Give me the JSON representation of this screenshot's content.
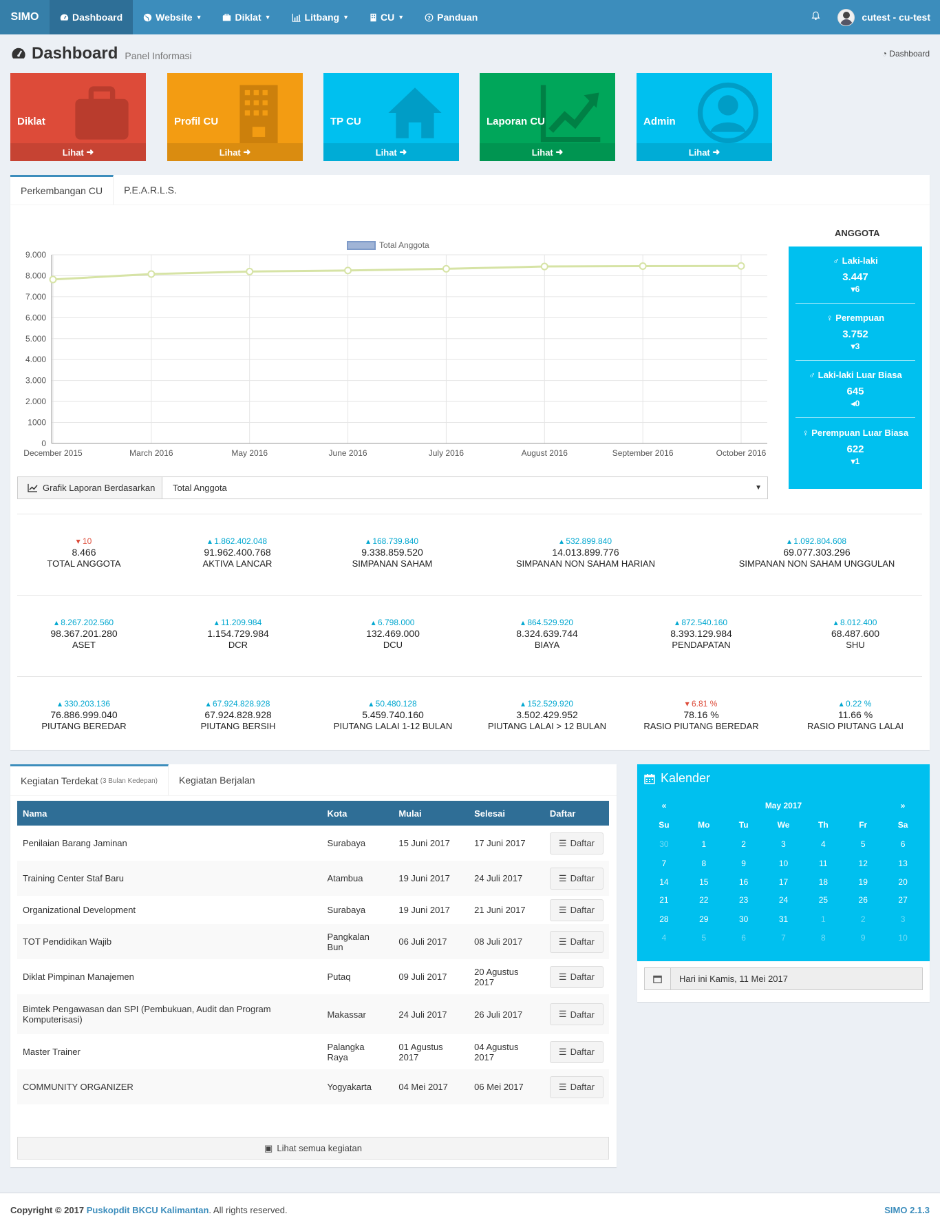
{
  "navbar": {
    "brand": "SIMO",
    "items": [
      {
        "label": "Dashboard",
        "caret": false
      },
      {
        "label": "Website",
        "caret": true
      },
      {
        "label": "Diklat",
        "caret": true
      },
      {
        "label": "Litbang",
        "caret": true
      },
      {
        "label": "CU",
        "caret": true
      },
      {
        "label": "Panduan",
        "caret": false
      }
    ],
    "user": "cutest - cu-test"
  },
  "header": {
    "title": "Dashboard",
    "subtitle": "Panel Informasi",
    "breadcrumb": "Dashboard"
  },
  "tiles": [
    {
      "title": "Diklat",
      "link": "Lihat",
      "color": "#dd4b39",
      "footer_color": "#c64333",
      "icon": "briefcase-icon"
    },
    {
      "title": "Profil CU",
      "link": "Lihat",
      "color": "#f39c12",
      "footer_color": "#da8c10",
      "icon": "building-icon"
    },
    {
      "title": "TP CU",
      "link": "Lihat",
      "color": "#00c0ef",
      "footer_color": "#00acd6",
      "icon": "home-icon"
    },
    {
      "title": "Laporan CU",
      "link": "Lihat",
      "color": "#00a65a",
      "footer_color": "#009551",
      "icon": "line-chart-icon"
    },
    {
      "title": "Admin",
      "link": "Lihat",
      "color": "#00c0ef",
      "footer_color": "#00acd6",
      "icon": "user-circle-icon"
    }
  ],
  "tabs": [
    "Perkembangan CU",
    "P.E.A.R.L.S."
  ],
  "chart_data": {
    "type": "line",
    "categories": [
      "December 2015",
      "March 2016",
      "May 2016",
      "June 2016",
      "July 2016",
      "August 2016",
      "September 2016",
      "October 2016"
    ],
    "series": [
      {
        "name": "Total Anggota",
        "values": [
          7820,
          8080,
          8200,
          8250,
          8330,
          8440,
          8460,
          8466
        ]
      }
    ],
    "ylim": [
      0,
      9000
    ],
    "yticks": [
      "0",
      "1000",
      "2.000",
      "3.000",
      "4.000",
      "5.000",
      "6.000",
      "7.000",
      "8.000",
      "9.000"
    ],
    "legend": "top",
    "grid": true,
    "line_color": "#d6e3a5"
  },
  "anggota": {
    "title": "ANGGOTA",
    "items": [
      {
        "label": "Laki-laki",
        "value": "3.447",
        "delta": "6",
        "dir": "down"
      },
      {
        "label": "Perempuan",
        "value": "3.752",
        "delta": "3",
        "dir": "down"
      },
      {
        "label": "Laki-laki Luar Biasa",
        "value": "645",
        "delta": "0",
        "dir": "left"
      },
      {
        "label": "Perempuan Luar Biasa",
        "value": "622",
        "delta": "1",
        "dir": "down"
      }
    ]
  },
  "grafik": {
    "label": "Grafik Laporan Berdasarkan",
    "selected": "Total Anggota"
  },
  "kpis_row1": [
    {
      "delta": "10",
      "up": false,
      "value": "8.466",
      "label": "TOTAL ANGGOTA"
    },
    {
      "delta": "1.862.402.048",
      "up": true,
      "value": "91.962.400.768",
      "label": "AKTIVA LANCAR"
    },
    {
      "delta": "168.739.840",
      "up": true,
      "value": "9.338.859.520",
      "label": "SIMPANAN SAHAM"
    },
    {
      "delta": "532.899.840",
      "up": true,
      "value": "14.013.899.776",
      "label": "SIMPANAN NON SAHAM HARIAN"
    },
    {
      "delta": "1.092.804.608",
      "up": true,
      "value": "69.077.303.296",
      "label": "SIMPANAN NON SAHAM UNGGULAN"
    }
  ],
  "kpis_row2": [
    {
      "delta": "8.267.202.560",
      "up": true,
      "value": "98.367.201.280",
      "label": "ASET"
    },
    {
      "delta": "11.209.984",
      "up": true,
      "value": "1.154.729.984",
      "label": "DCR"
    },
    {
      "delta": "6.798.000",
      "up": true,
      "value": "132.469.000",
      "label": "DCU"
    },
    {
      "delta": "864.529.920",
      "up": true,
      "value": "8.324.639.744",
      "label": "BIAYA"
    },
    {
      "delta": "872.540.160",
      "up": true,
      "value": "8.393.129.984",
      "label": "PENDAPATAN"
    },
    {
      "delta": "8.012.400",
      "up": true,
      "value": "68.487.600",
      "label": "SHU"
    }
  ],
  "kpis_row3": [
    {
      "delta": "330.203.136",
      "up": true,
      "value": "76.886.999.040",
      "label": "PIUTANG BEREDAR"
    },
    {
      "delta": "67.924.828.928",
      "up": true,
      "value": "67.924.828.928",
      "label": "PIUTANG BERSIH"
    },
    {
      "delta": "50.480.128",
      "up": true,
      "value": "5.459.740.160",
      "label": "PIUTANG LALAI 1-12 BULAN"
    },
    {
      "delta": "152.529.920",
      "up": true,
      "value": "3.502.429.952",
      "label": "PIUTANG LALAI > 12 BULAN"
    },
    {
      "delta": "6.81 %",
      "up": false,
      "value": "78.16 %",
      "label": "RASIO PIUTANG BEREDAR"
    },
    {
      "delta": "0.22 %",
      "up": true,
      "value": "11.66 %",
      "label": "RASIO PIUTANG LALAI"
    }
  ],
  "kegiatan": {
    "tab1": "Kegiatan Terdekat",
    "tab1_small": "(3 Bulan Kedepan)",
    "tab2": "Kegiatan Berjalan",
    "columns": [
      "Nama",
      "Kota",
      "Mulai",
      "Selesai",
      "Daftar"
    ],
    "rows": [
      {
        "nama": "Penilaian Barang Jaminan",
        "kota": "Surabaya",
        "mulai": "15 Juni 2017",
        "selesai": "17 Juni 2017",
        "btn": "Daftar"
      },
      {
        "nama": "Training Center Staf Baru",
        "kota": "Atambua",
        "mulai": "19 Juni 2017",
        "selesai": "24 Juli 2017",
        "btn": "Daftar"
      },
      {
        "nama": "Organizational Development",
        "kota": "Surabaya",
        "mulai": "19 Juni 2017",
        "selesai": "21 Juni 2017",
        "btn": "Daftar"
      },
      {
        "nama": "TOT Pendidikan Wajib",
        "kota": "Pangkalan Bun",
        "mulai": "06 Juli 2017",
        "selesai": "08 Juli 2017",
        "btn": "Daftar"
      },
      {
        "nama": "Diklat Pimpinan Manajemen",
        "kota": "Putaq",
        "mulai": "09 Juli 2017",
        "selesai": "20 Agustus 2017",
        "btn": "Daftar"
      },
      {
        "nama": "Bimtek Pengawasan dan SPI (Pembukuan, Audit dan Program Komputerisasi)",
        "kota": "Makassar",
        "mulai": "24 Juli 2017",
        "selesai": "26 Juli 2017",
        "btn": "Daftar"
      },
      {
        "nama": "Master Trainer",
        "kota": "Palangka Raya",
        "mulai": "01 Agustus 2017",
        "selesai": "04 Agustus 2017",
        "btn": "Daftar"
      },
      {
        "nama": "COMMUNITY ORGANIZER",
        "kota": "Yogyakarta",
        "mulai": "04 Mei 2017",
        "selesai": "06 Mei 2017",
        "btn": "Daftar"
      }
    ],
    "lihat_semua": "Lihat semua kegiatan"
  },
  "kalender": {
    "title": "Kalender",
    "month": "May 2017",
    "prev": "«",
    "next": "»",
    "days": [
      "Su",
      "Mo",
      "Tu",
      "We",
      "Th",
      "Fr",
      "Sa"
    ],
    "weeks": [
      [
        "30",
        "1",
        "2",
        "3",
        "4",
        "5",
        "6"
      ],
      [
        "7",
        "8",
        "9",
        "10",
        "11",
        "12",
        "13"
      ],
      [
        "14",
        "15",
        "16",
        "17",
        "18",
        "19",
        "20"
      ],
      [
        "21",
        "22",
        "23",
        "24",
        "25",
        "26",
        "27"
      ],
      [
        "28",
        "29",
        "30",
        "31",
        "1",
        "2",
        "3"
      ],
      [
        "4",
        "5",
        "6",
        "7",
        "8",
        "9",
        "10"
      ]
    ],
    "today_text": "Hari ini Kamis, 11 Mei 2017"
  },
  "footer": {
    "copy": "Copyright © 2017",
    "org": "Puskopdit BKCU Kalimantan",
    "rights": ". All rights reserved.",
    "version": "SIMO 2.1.3"
  }
}
